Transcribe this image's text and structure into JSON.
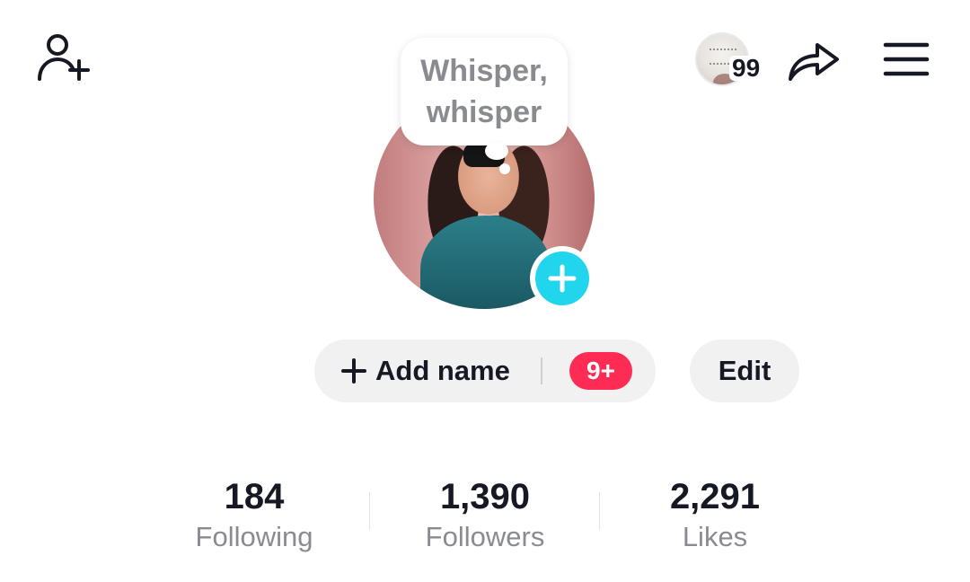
{
  "header": {
    "mini_avatar_badge": "99"
  },
  "speech_bubble": {
    "line1": "Whisper,",
    "line2": "whisper"
  },
  "actions": {
    "add_name_label": "Add name",
    "notification_badge": "9+",
    "edit_label": "Edit"
  },
  "stats": [
    {
      "value": "184",
      "label": "Following"
    },
    {
      "value": "1,390",
      "label": "Followers"
    },
    {
      "value": "2,291",
      "label": "Likes"
    }
  ],
  "icons": {
    "add_friend": "add-user-icon",
    "share": "share-arrow-icon",
    "menu": "hamburger-menu-icon",
    "avatar_add": "plus-icon"
  },
  "colors": {
    "accent_cyan": "#20d5ec",
    "badge_red": "#fe2c55",
    "text_primary": "#161823",
    "text_secondary": "#8a8b91",
    "button_bg": "#f1f1f2"
  }
}
